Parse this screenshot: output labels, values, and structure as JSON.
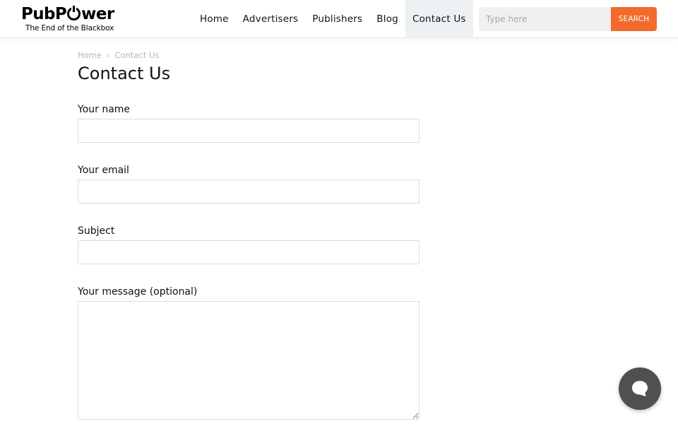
{
  "brand": {
    "name_part1": "Pub",
    "name_o": "o",
    "name_part2": "wer",
    "name_prefix_p": "P",
    "tagline": "The End of the Blackbox"
  },
  "nav": {
    "items": [
      {
        "label": "Home"
      },
      {
        "label": "Advertisers"
      },
      {
        "label": "Publishers"
      },
      {
        "label": "Blog"
      },
      {
        "label": "Contact Us",
        "active": true
      }
    ]
  },
  "search": {
    "placeholder": "Type here",
    "button_label": "SEARCH"
  },
  "breadcrumb": {
    "home": "Home",
    "separator": "›",
    "current": "Contact Us"
  },
  "page": {
    "title": "Contact Us"
  },
  "form": {
    "name_label": "Your name",
    "name_value": "",
    "email_label": "Your email",
    "email_value": "",
    "subject_label": "Subject",
    "subject_value": "",
    "message_label": "Your message (optional)",
    "message_value": ""
  },
  "colors": {
    "accent": "#f26a2e",
    "chat_button": "#505050",
    "active_nav_bg": "#eef1f3"
  },
  "icons": {
    "chat": "chat-bubble-icon"
  }
}
